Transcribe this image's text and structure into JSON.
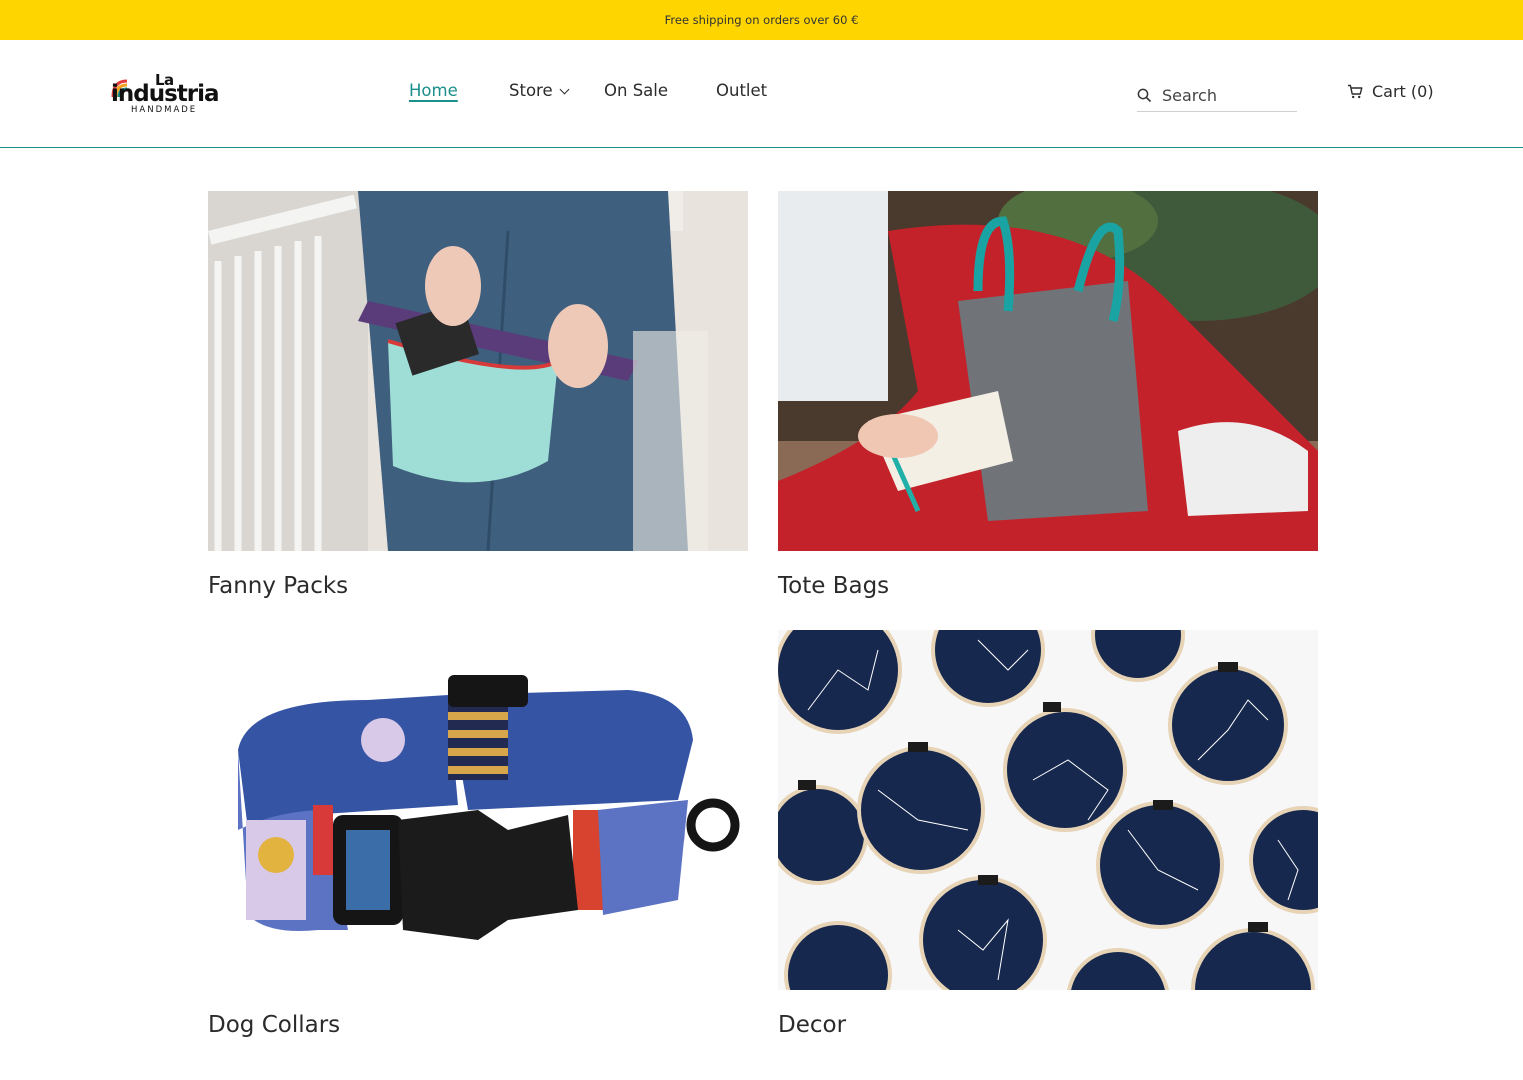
{
  "announcement": "Free shipping on orders over 60 €",
  "logo": {
    "top": "La",
    "word": "industria",
    "sub": "HANDMADE"
  },
  "nav": [
    {
      "label": "Home",
      "active": true
    },
    {
      "label": "Store",
      "dropdown": true
    },
    {
      "label": "On Sale"
    },
    {
      "label": "Outlet"
    }
  ],
  "search": {
    "placeholder": "Search"
  },
  "cart": {
    "label": "Cart (0)"
  },
  "categories": [
    {
      "title": "Fanny Packs"
    },
    {
      "title": "Tote Bags"
    },
    {
      "title": "Dog Collars"
    },
    {
      "title": "Decor"
    }
  ],
  "colors": {
    "announce_bg": "#ffd500",
    "accent": "#1b8f8a",
    "text": "#2b2b2b"
  }
}
